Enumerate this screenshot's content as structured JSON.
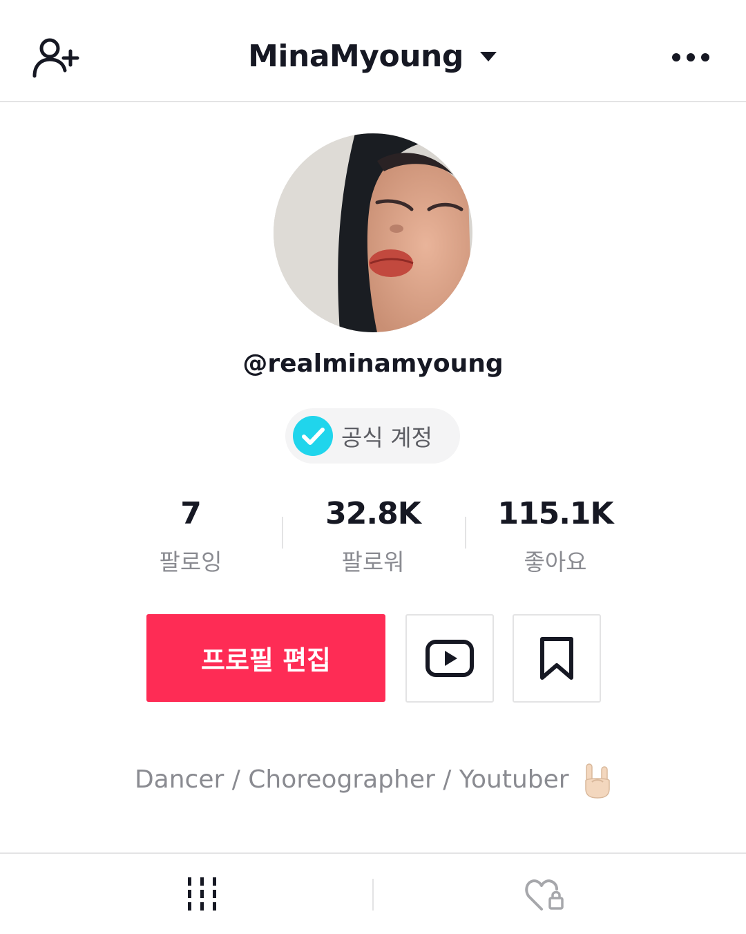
{
  "header": {
    "username": "MinaMyoung",
    "add_user_icon": "person-add-icon",
    "dropdown_icon": "caret-down-icon",
    "more_icon": "more-dots-icon"
  },
  "profile": {
    "handle": "@realminamyoung",
    "badge_label": "공식 계정",
    "badge_icon": "verified-check-icon",
    "badge_color": "#20d5ec"
  },
  "stats": [
    {
      "value": "7",
      "label": "팔로잉"
    },
    {
      "value": "32.8K",
      "label": "팔로워"
    },
    {
      "value": "115.1K",
      "label": "좋아요"
    }
  ],
  "actions": {
    "edit_label": "프로필 편집",
    "edit_color": "#fe2c55",
    "youtube_icon": "youtube-icon",
    "bookmark_icon": "bookmark-icon"
  },
  "bio": {
    "text": "Dancer / Choreographer / Youtuber",
    "emoji": "🤘🏻"
  },
  "tabs": [
    {
      "icon": "grid-icon",
      "active": true
    },
    {
      "icon": "liked-locked-icon",
      "active": false
    }
  ]
}
